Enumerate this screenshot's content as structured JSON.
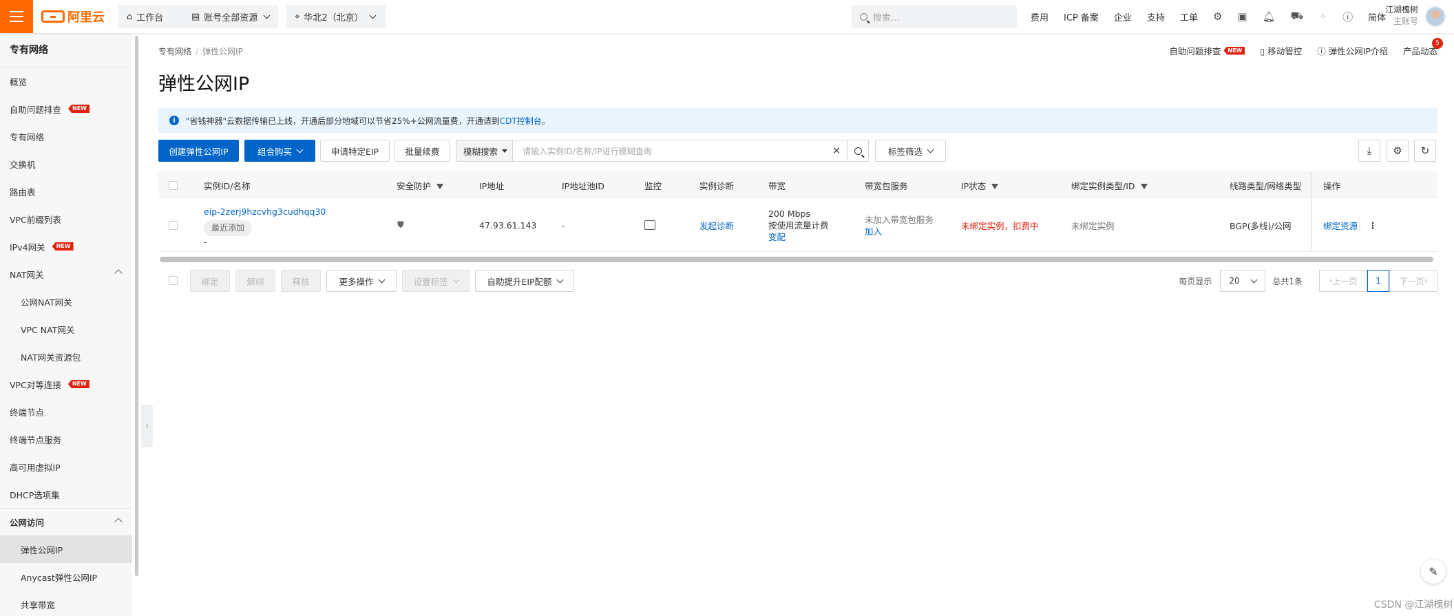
{
  "topbar": {
    "logo_text": "阿里云",
    "nav": [
      {
        "label": "工作台",
        "icon": "home-icon"
      },
      {
        "label": "账号全部资源",
        "icon": "list-icon"
      },
      {
        "label": "华北2（北京）",
        "icon": "location-icon"
      }
    ],
    "search_placeholder": "搜索...",
    "links": [
      "费用",
      "ICP 备案",
      "企业",
      "支持",
      "工单"
    ],
    "lang": "简体",
    "user_name": "江湖槐树",
    "user_role": "主账号"
  },
  "sidebar": {
    "title": "专有网络",
    "items": [
      {
        "label": "概览"
      },
      {
        "label": "自助问题排查",
        "badge": "NEW"
      },
      {
        "label": "专有网络"
      },
      {
        "label": "交换机"
      },
      {
        "label": "路由表"
      },
      {
        "label": "VPC前缀列表"
      },
      {
        "label": "IPv4网关",
        "badge": "NEW"
      },
      {
        "label": "NAT网关"
      },
      {
        "label": "公网NAT网关"
      },
      {
        "label": "VPC NAT网关"
      },
      {
        "label": "NAT网关资源包"
      },
      {
        "label": "VPC对等连接",
        "badge": "NEW"
      },
      {
        "label": "终端节点"
      },
      {
        "label": "终端节点服务"
      },
      {
        "label": "高可用虚拟IP"
      },
      {
        "label": "DHCP选项集"
      },
      {
        "label": "公网访问"
      },
      {
        "label": "弹性公网IP"
      },
      {
        "label": "Anycast弹性公网IP"
      },
      {
        "label": "共享带宽"
      }
    ]
  },
  "page": {
    "breadcrumb": [
      "专有网络",
      "弹性公网IP"
    ],
    "title": "弹性公网IP",
    "top_links": {
      "troubleshoot": "自助问题排查",
      "troubleshoot_badge": "NEW",
      "mobile": "移动管控",
      "intro": "弹性公网IP介绍",
      "news": "产品动态",
      "news_count": "5"
    },
    "notice": {
      "text": "\"省钱神器\"云数据传输已上线，开通后部分地域可以节省25%+公网流量费，开通请到",
      "link": "CDT控制台",
      "end": "。"
    }
  },
  "toolbar": {
    "create": "创建弹性公网IP",
    "combo": "组合购买",
    "apply_specific": "申请特定EIP",
    "batch_renew": "批量续费",
    "search_mode": "模糊搜索",
    "search_placeholder": "请输入实例ID/名称/IP进行模糊查询",
    "tag_filter": "标签筛选"
  },
  "table": {
    "columns": [
      "实例ID/名称",
      "安全防护",
      "IP地址",
      "IP地址池ID",
      "监控",
      "实例诊断",
      "带宽",
      "带宽包服务",
      "IP状态",
      "绑定实例类型/ID",
      "线路类型/网络类型",
      "操作"
    ],
    "rows": [
      {
        "id": "eip-2zerj9hzcvhg3cudhqq30",
        "tag": "最近添加",
        "name": "-",
        "ip": "47.93.61.143",
        "pool": "-",
        "diagnose": "发起诊断",
        "bandwidth": "200 Mbps",
        "billing": "按使用流量计费",
        "change": "变配",
        "pkg_status": "未加入带宽包服务",
        "pkg_join": "加入",
        "ip_status": "未绑定实例，扣费中",
        "bind": "未绑定实例",
        "line": "BGP(多线)/公网",
        "op": "绑定资源"
      }
    ]
  },
  "footer_actions": {
    "bind": "绑定",
    "unbind": "解绑",
    "release": "释放",
    "more": "更多操作",
    "set_tags": "设置标签",
    "auto_raise": "自助提升EIP配额"
  },
  "pagination": {
    "per_page_label": "每页显示",
    "per_page": "20",
    "total": "总共1条",
    "prev": "上一页",
    "current": "1",
    "next": "下一页"
  },
  "watermark": "CSDN @江湖槐树",
  "colors": {
    "brand": "#ff6a00",
    "primary": "#0064c8",
    "danger": "#e0230e"
  }
}
